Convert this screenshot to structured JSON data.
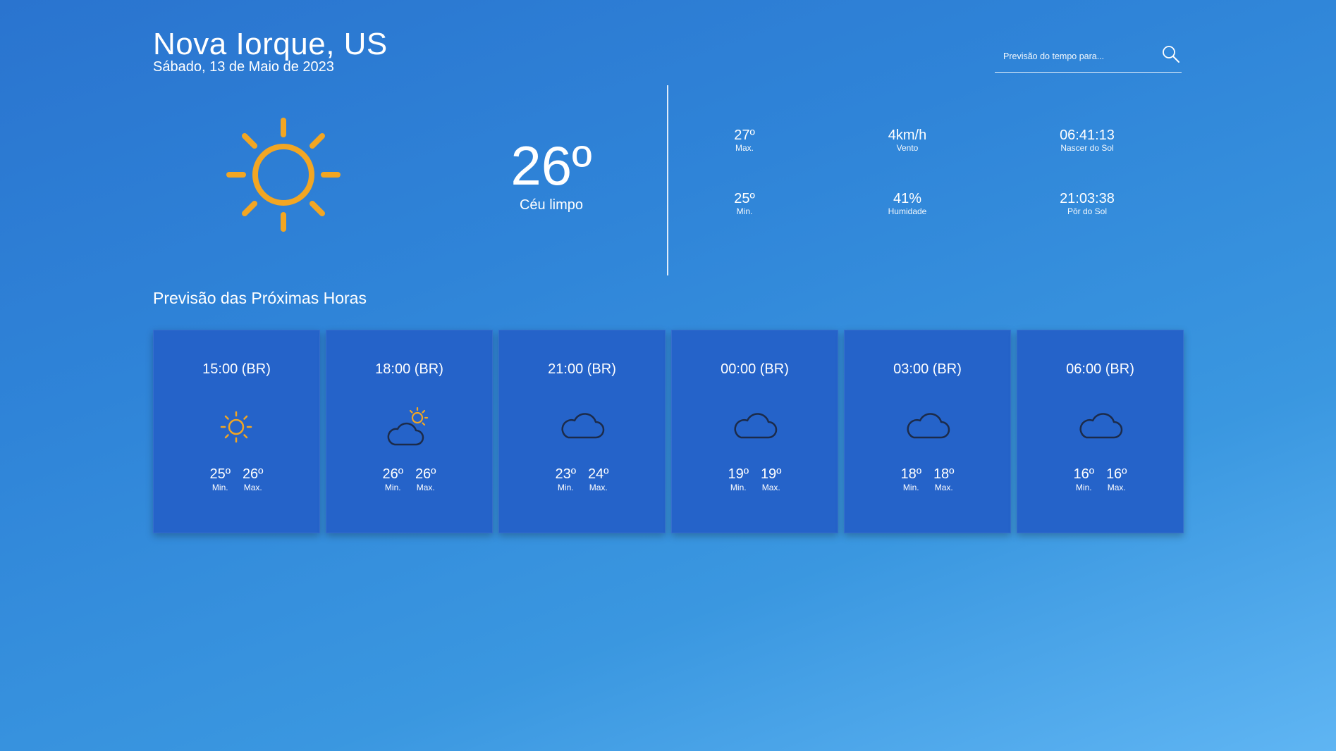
{
  "header": {
    "location": "Nova Iorque, US",
    "date": "Sábado, 13 de Maio de 2023"
  },
  "search": {
    "placeholder": "Previsão do tempo para..."
  },
  "current": {
    "temperature": "26º",
    "description": "Céu limpo",
    "icon": "sun-icon"
  },
  "stats": {
    "max": {
      "value": "27º",
      "label": "Max."
    },
    "min": {
      "value": "25º",
      "label": "Min."
    },
    "wind": {
      "value": "4km/h",
      "label": "Vento"
    },
    "humidity": {
      "value": "41%",
      "label": "Humidade"
    },
    "sunrise": {
      "value": "06:41:13",
      "label": "Nascer do Sol"
    },
    "sunset": {
      "value": "21:03:38",
      "label": "Pôr do Sol"
    }
  },
  "forecast": {
    "title": "Previsão das Próximas Horas",
    "min_label": "Min.",
    "max_label": "Max.",
    "items": [
      {
        "time": "15:00 (BR)",
        "icon": "sun-icon",
        "min": "25º",
        "max": "26º"
      },
      {
        "time": "18:00 (BR)",
        "icon": "partly-cloudy-icon",
        "min": "26º",
        "max": "26º"
      },
      {
        "time": "21:00 (BR)",
        "icon": "cloud-icon",
        "min": "23º",
        "max": "24º"
      },
      {
        "time": "00:00 (BR)",
        "icon": "cloud-icon",
        "min": "19º",
        "max": "19º"
      },
      {
        "time": "03:00 (BR)",
        "icon": "cloud-icon",
        "min": "18º",
        "max": "18º"
      },
      {
        "time": "06:00 (BR)",
        "icon": "cloud-icon",
        "min": "16º",
        "max": "16º"
      }
    ]
  },
  "colors": {
    "sun": "#f2a623",
    "cloud_outline": "#1c2b4a",
    "card_bg": "#2563c9"
  }
}
